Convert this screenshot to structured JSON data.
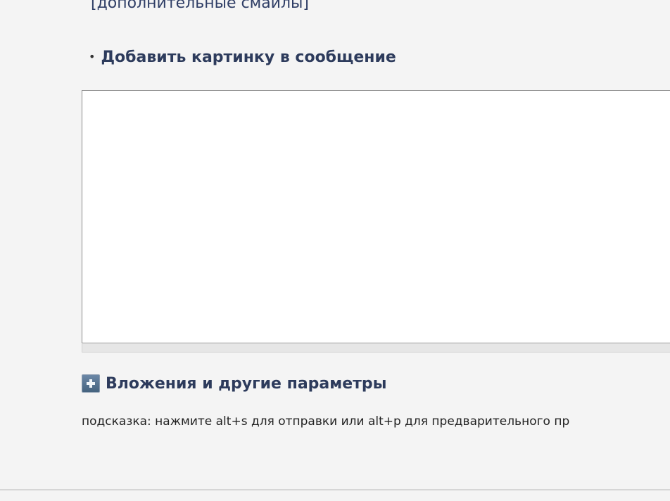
{
  "smilies": {
    "more_link": "[дополнительные смайлы]"
  },
  "add_image": {
    "bullet": "•",
    "label": "Добавить картинку в сообщение"
  },
  "editor": {
    "value": "",
    "placeholder": ""
  },
  "attachments": {
    "icon": "plus-square-icon",
    "label": "Вложения и другие параметры"
  },
  "hint": {
    "text": "подсказка: нажмите alt+s для отправки или alt+p для предварительного пр"
  }
}
